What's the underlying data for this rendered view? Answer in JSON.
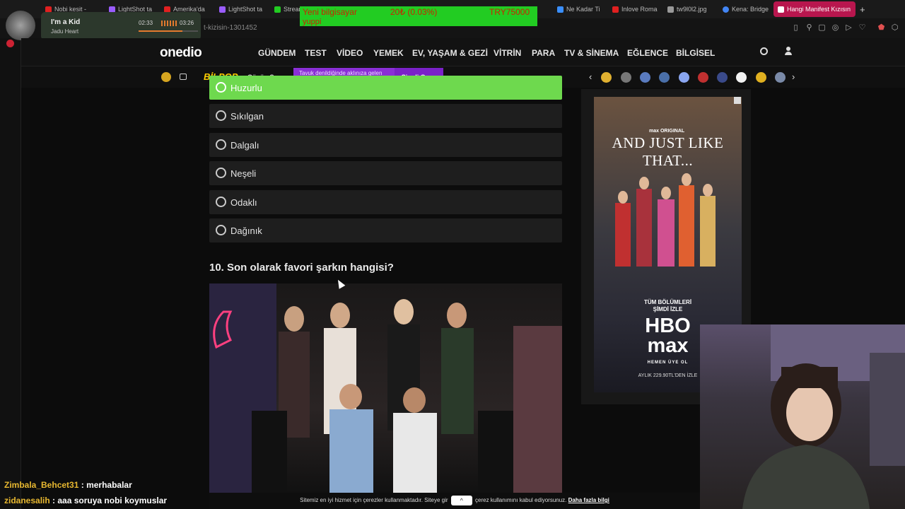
{
  "browser": {
    "tabs": [
      {
        "label": "Nobi kesit -",
        "color": "#e02020"
      },
      {
        "label": "LightShot ta",
        "color": "#9a5cff"
      },
      {
        "label": "Amerika'da",
        "color": "#e02020"
      },
      {
        "label": "LightShot ta",
        "color": "#9a5cff"
      },
      {
        "label": "Stream",
        "color": "#22cc22"
      },
      {
        "label": "Ne Kadar Ti",
        "color": "#3a8fff"
      },
      {
        "label": "Inlove Roma",
        "color": "#e02020"
      },
      {
        "label": "tw9l0l2.jpg",
        "color": "#999999"
      },
      {
        "label": "Kena: Bridge",
        "color": "#4285f4"
      },
      {
        "label": "Hangi Manifest Kızısın",
        "color": "#b8164e"
      }
    ],
    "url": "t-kizisin-1301452"
  },
  "music": {
    "song": "I'm a Kid",
    "artist": "Jadu Heart",
    "elapsed": "02:33",
    "total": "03:26",
    "progress": 0.74
  },
  "donation": {
    "line1_a": "Yeni bilgisayar",
    "line1_b": "20₺ (0.03%)",
    "line1_c": "TRY75000",
    "line2": "yuppi"
  },
  "site": {
    "logo": "onedio",
    "nav": [
      "GÜNDEM",
      "TEST",
      "VİDEO",
      "YEMEK",
      "EV, YAŞAM & GEZİ",
      "VİTRİN",
      "PARA",
      "TV & SİNEMA",
      "EĞLENCE",
      "BİLGİSEL"
    ],
    "bilpop": "BİLPOP",
    "gunun_sorusu": "Günün Sorusu",
    "promo_text": "Tavuk denildiğinde aklınıza gelen bir şey söyleyin.",
    "play_label": "Şimdi Oyna"
  },
  "quiz": {
    "answers": [
      {
        "label": "Huzurlu",
        "selected": true
      },
      {
        "label": "Sıkılgan",
        "selected": false
      },
      {
        "label": "Dalgalı",
        "selected": false
      },
      {
        "label": "Neşeli",
        "selected": false
      },
      {
        "label": "Odaklı",
        "selected": false
      },
      {
        "label": "Dağınık",
        "selected": false
      }
    ],
    "question_10": "10. Son olarak favori şarkın hangisi?"
  },
  "ad": {
    "max_original": "max ORIGINAL",
    "title": "AND JUST LIKE THAT...",
    "cta_line1": "TÜM BÖLÜMLERİ",
    "cta_line2": "ŞİMDİ İZLE",
    "brand_line1": "HBO",
    "brand_line2": "max",
    "subscribe": "HEMEN ÜYE OL",
    "price": "AYLIK 229.90TL'DEN İZLE"
  },
  "chat": [
    {
      "user": "Zimbala_Behcet31",
      "message": "merhabalar"
    },
    {
      "user": "zidanesalih",
      "message": "aaa soruya nobi koymuslar"
    }
  ],
  "cookie": {
    "text_a": "Sitemiz en iyi hizmet için çerezler kullanmaktadır. Siteye gir",
    "text_b": "çerez kullanımını kabul ediyorsunuz.",
    "link": "Daha fazla bilgi"
  }
}
